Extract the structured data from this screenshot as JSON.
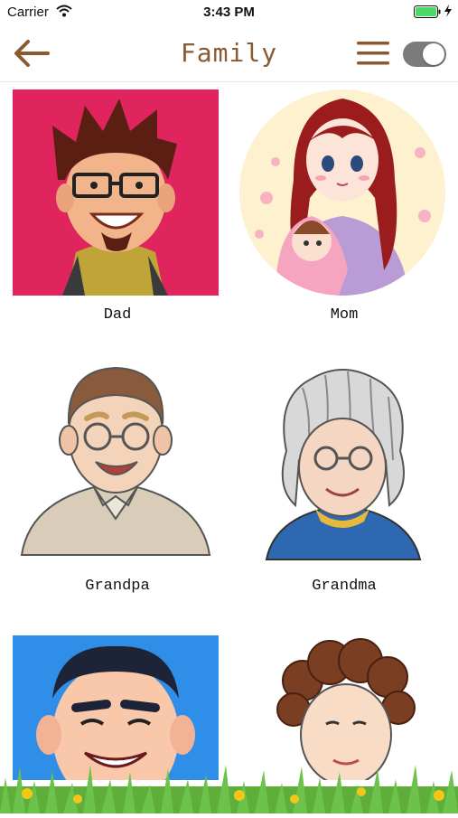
{
  "status": {
    "carrier": "Carrier",
    "time": "3:43 PM"
  },
  "header": {
    "title": "Family"
  },
  "members": [
    {
      "name": "Dad"
    },
    {
      "name": "Mom"
    },
    {
      "name": "Grandpa"
    },
    {
      "name": "Grandma"
    },
    {
      "name": ""
    },
    {
      "name": ""
    }
  ],
  "colors": {
    "title": "#8a5a32",
    "dad_bg": "#e0245e",
    "mom_bg": "#fdf1cf",
    "uncle_bg": "#2f8ee8",
    "toggle": "#7b7b7b",
    "grass": "#6cc24a"
  },
  "icons": [
    "back-arrow-icon",
    "menu-icon",
    "toggle-switch",
    "wifi-icon",
    "battery-icon"
  ]
}
